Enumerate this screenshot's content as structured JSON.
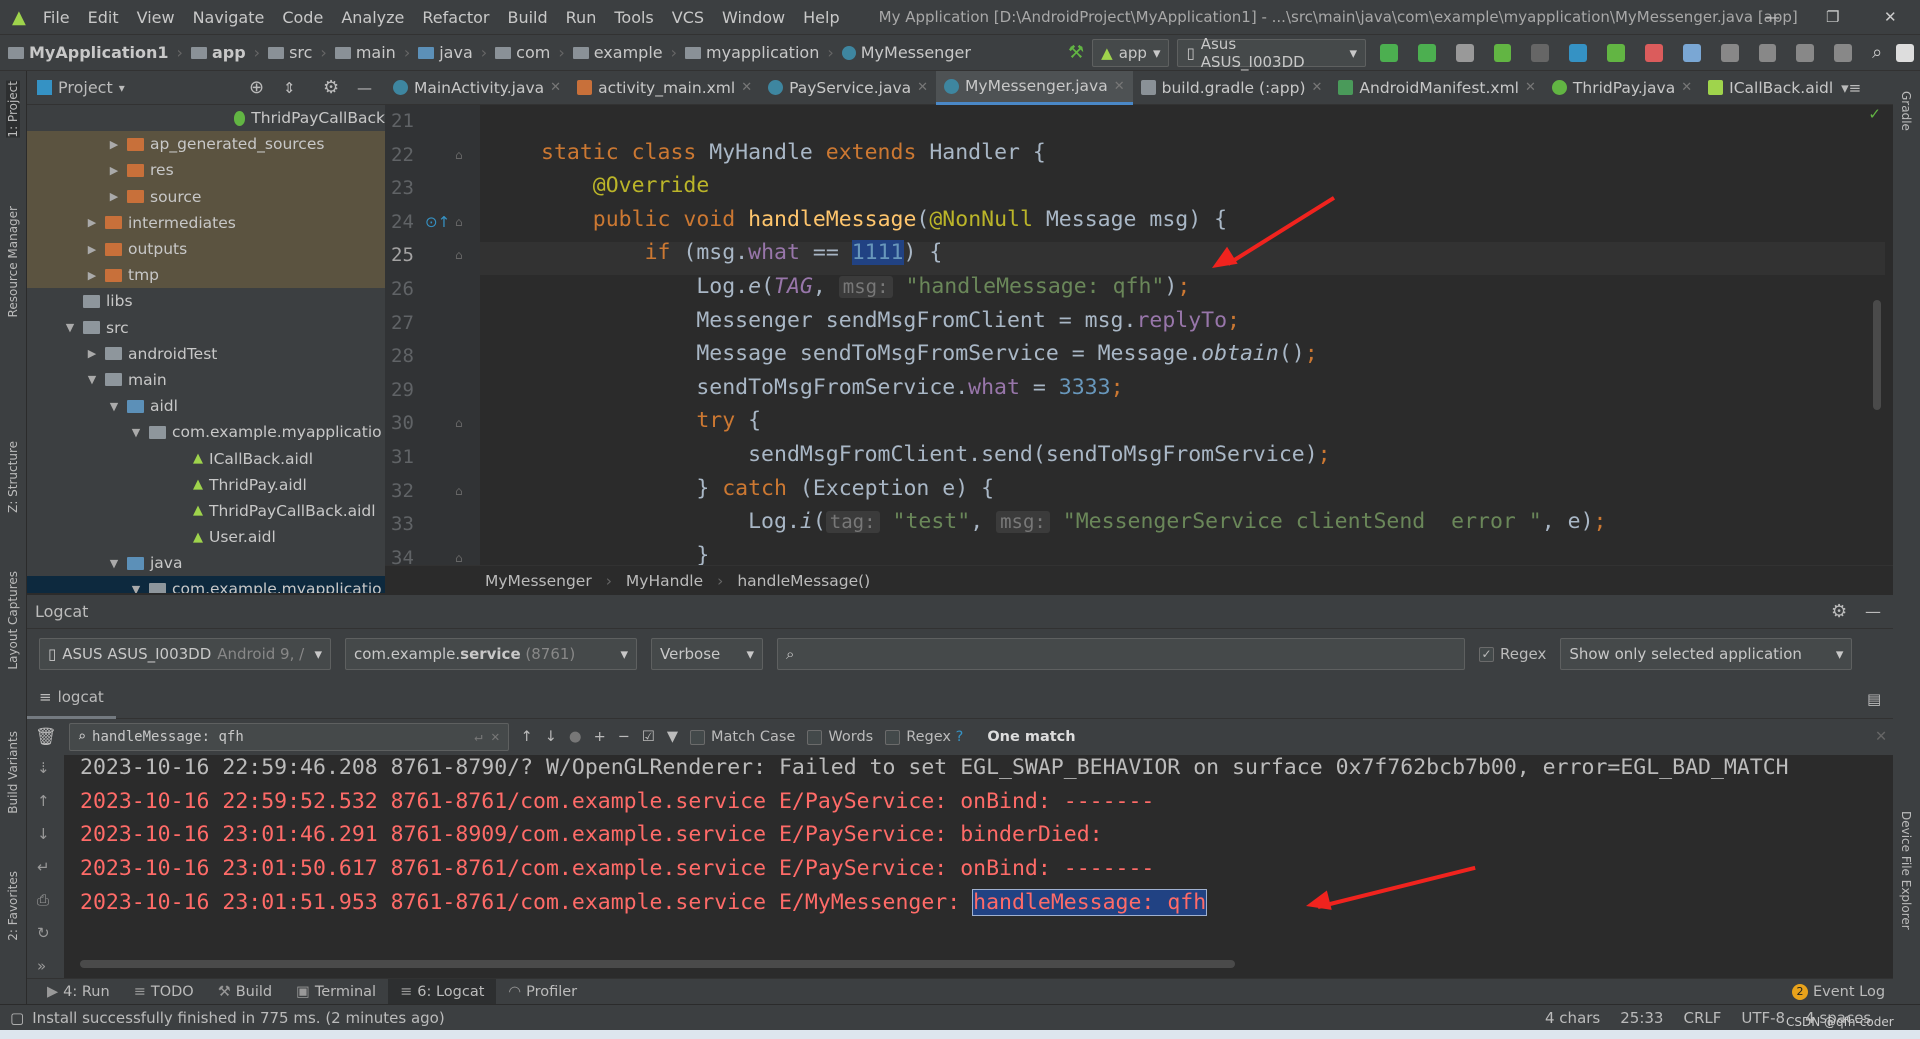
{
  "menu": {
    "items": [
      "File",
      "Edit",
      "View",
      "Navigate",
      "Code",
      "Analyze",
      "Refactor",
      "Build",
      "Run",
      "Tools",
      "VCS",
      "Window",
      "Help"
    ],
    "title": "My Application [D:\\AndroidProject\\MyApplication1] - ...\\src\\main\\java\\com\\example\\myapplication\\MyMessenger.java [app]"
  },
  "nav": {
    "crumbs": [
      "MyApplication1",
      "app",
      "src",
      "main",
      "java",
      "com",
      "example",
      "myapplication",
      "MyMessenger"
    ],
    "run_config": "app",
    "device": "Asus ASUS_I003DD"
  },
  "project": {
    "title": "Project",
    "tree": [
      {
        "label": "ThridPayCallBack",
        "depth": 9,
        "type": "c",
        "cls": ""
      },
      {
        "label": "ap_generated_sources",
        "depth": 4,
        "type": "or",
        "arrow": "▶",
        "cls": "excl"
      },
      {
        "label": "res",
        "depth": 4,
        "type": "or",
        "arrow": "▶",
        "cls": "excl"
      },
      {
        "label": "source",
        "depth": 4,
        "type": "or",
        "arrow": "▶",
        "cls": "excl"
      },
      {
        "label": "intermediates",
        "depth": 3,
        "type": "or",
        "arrow": "▶",
        "cls": "excl"
      },
      {
        "label": "outputs",
        "depth": 3,
        "type": "or",
        "arrow": "▶",
        "cls": "excl"
      },
      {
        "label": "tmp",
        "depth": 3,
        "type": "or",
        "arrow": "▶",
        "cls": "excl"
      },
      {
        "label": "libs",
        "depth": 2,
        "type": "gr",
        "cls": ""
      },
      {
        "label": "src",
        "depth": 2,
        "type": "gr",
        "arrow": "▼",
        "cls": ""
      },
      {
        "label": "androidTest",
        "depth": 3,
        "type": "gr",
        "arrow": "▶",
        "cls": ""
      },
      {
        "label": "main",
        "depth": 3,
        "type": "gr",
        "arrow": "▼",
        "cls": ""
      },
      {
        "label": "aidl",
        "depth": 4,
        "type": "bl",
        "arrow": "▼",
        "cls": ""
      },
      {
        "label": "com.example.myapplicatio",
        "depth": 5,
        "type": "gr",
        "arrow": "▼",
        "cls": ""
      },
      {
        "label": "ICallBack.aidl",
        "depth": 7,
        "type": "droid",
        "cls": ""
      },
      {
        "label": "ThridPay.aidl",
        "depth": 7,
        "type": "droid",
        "cls": ""
      },
      {
        "label": "ThridPayCallBack.aidl",
        "depth": 7,
        "type": "droid",
        "cls": ""
      },
      {
        "label": "User.aidl",
        "depth": 7,
        "type": "droid",
        "cls": ""
      },
      {
        "label": "java",
        "depth": 4,
        "type": "bl",
        "arrow": "▼",
        "cls": ""
      },
      {
        "label": "com.example.myapplicatio",
        "depth": 5,
        "type": "gr",
        "arrow": "▼",
        "cls": "sel"
      }
    ]
  },
  "tabs": [
    {
      "label": "MainActivity.java",
      "icon": "class"
    },
    {
      "label": "activity_main.xml",
      "icon": "xml"
    },
    {
      "label": "PayService.java",
      "icon": "class"
    },
    {
      "label": "MyMessenger.java",
      "icon": "class",
      "active": true
    },
    {
      "label": "build.gradle (:app)",
      "icon": "gradle"
    },
    {
      "label": "AndroidManifest.xml",
      "icon": "manifest"
    },
    {
      "label": "ThridPay.java",
      "icon": "interface"
    },
    {
      "label": "ICallBack.aidl",
      "icon": "aidl"
    }
  ],
  "editor": {
    "current_line": 25,
    "lines": [
      {
        "n": "21",
        "html": ""
      },
      {
        "n": "22",
        "html": "<span class='kw'>static class </span>MyHandle <span class='kw'>extends </span>Handler {"
      },
      {
        "n": "23",
        "html": "    <span class='an'>@Override</span>"
      },
      {
        "n": "24",
        "html": "    <span class='kw'>public void </span><span class='fn'>handleMessage</span>(<span class='an'>@NonNull </span>Message msg) {"
      },
      {
        "n": "25",
        "html": "        <span class='kw'>if </span>(msg.<span class='fd'>what </span>== <span class='nm selnum'>1111</span>) {"
      },
      {
        "n": "26",
        "html": "            Log.<span class='it'>e</span>(<span class='fd it'>TAG</span>, <span class='hint'>msg:</span> <span class='st'>\"handleMessage: qfh\"</span>)<span class='kw'>;</span>"
      },
      {
        "n": "27",
        "html": "            Messenger sendMsgFromClient = msg.<span class='fd'>replyTo</span><span class='kw'>;</span>"
      },
      {
        "n": "28",
        "html": "            Message sendToMsgFromService = Message.<span class='it'>obtain</span>()<span class='kw'>;</span>"
      },
      {
        "n": "29",
        "html": "            sendToMsgFromService.<span class='fd'>what </span>= <span class='nm'>3333</span><span class='kw'>;</span>"
      },
      {
        "n": "30",
        "html": "            <span class='kw'>try </span>{"
      },
      {
        "n": "31",
        "html": "                sendMsgFromClient.send(sendToMsgFromService)<span class='kw'>;</span>"
      },
      {
        "n": "32",
        "html": "            } <span class='kw'>catch </span>(Exception e) {"
      },
      {
        "n": "33",
        "html": "                Log.<span class='it'>i</span>(<span class='hint'>tag:</span> <span class='st'>\"test\"</span>, <span class='hint'>msg:</span> <span class='st'>\"MessengerService clientSend  error \"</span>, e)<span class='kw'>;</span>"
      },
      {
        "n": "34",
        "html": "            }"
      }
    ]
  },
  "breadcrumb": [
    "MyMessenger",
    "MyHandle",
    "handleMessage()"
  ],
  "logcat": {
    "title": "Logcat",
    "device": "ASUS ASUS_I003DD",
    "device_suffix": "Android 9, /",
    "process": "com.example.",
    "process_bold": "service",
    "pid": "(8761)",
    "level": "Verbose",
    "search_placeholder": "",
    "regex_label": "Regex",
    "regex_checked": true,
    "filter": "Show only selected application",
    "subtab": "logcat",
    "find": {
      "value": "handleMessage: qfh",
      "match_case": "Match Case",
      "words": "Words",
      "regex": "Regex",
      "help": "?",
      "result": "One match"
    },
    "lines": [
      {
        "text": "2023-10-16 22:59:46.208 8761-8790/? W/OpenGLRenderer: Failed to set EGL_SWAP_BEHAVIOR on surface 0x7f762bcb7b00, error=EGL_BAD_MATCH",
        "level": "w"
      },
      {
        "text": "2023-10-16 22:59:52.532 8761-8761/com.example.service E/PayService: onBind: -------",
        "level": "e"
      },
      {
        "text": "2023-10-16 23:01:46.291 8761-8909/com.example.service E/PayService: binderDied:",
        "level": "e"
      },
      {
        "text": "2023-10-16 23:01:50.617 8761-8761/com.example.service E/PayService: onBind: -------",
        "level": "e"
      },
      {
        "text": "2023-10-16 23:01:51.953 8761-8761/com.example.service E/MyMessenger: ",
        "match": "handleMessage: qfh",
        "level": "e"
      }
    ]
  },
  "tooltabs": [
    {
      "label": "4: Run"
    },
    {
      "label": "TODO"
    },
    {
      "label": "Build"
    },
    {
      "label": "Terminal"
    },
    {
      "label": "6: Logcat",
      "active": true
    },
    {
      "label": "Profiler"
    }
  ],
  "event_log": "Event Log",
  "event_count": "2",
  "status": {
    "message": "Install successfully finished in 775 ms. (2 minutes ago)",
    "chars": "4 chars",
    "pos": "25:33",
    "eol": "CRLF",
    "enc": "UTF-8",
    "indent": "4 spaces",
    "watermark": "CSDN @qfh-coder"
  },
  "side": {
    "left": [
      "1: Project",
      "Resource Manager",
      "Z: Structure",
      "Layout Captures",
      "Build Variants",
      "2: Favorites"
    ],
    "right": [
      "Gradle",
      "Device File Explorer"
    ]
  },
  "colors": {
    "error": "#ff6b68",
    "accent": "#4a88c7",
    "annotation_arrow": "#f0231e"
  }
}
